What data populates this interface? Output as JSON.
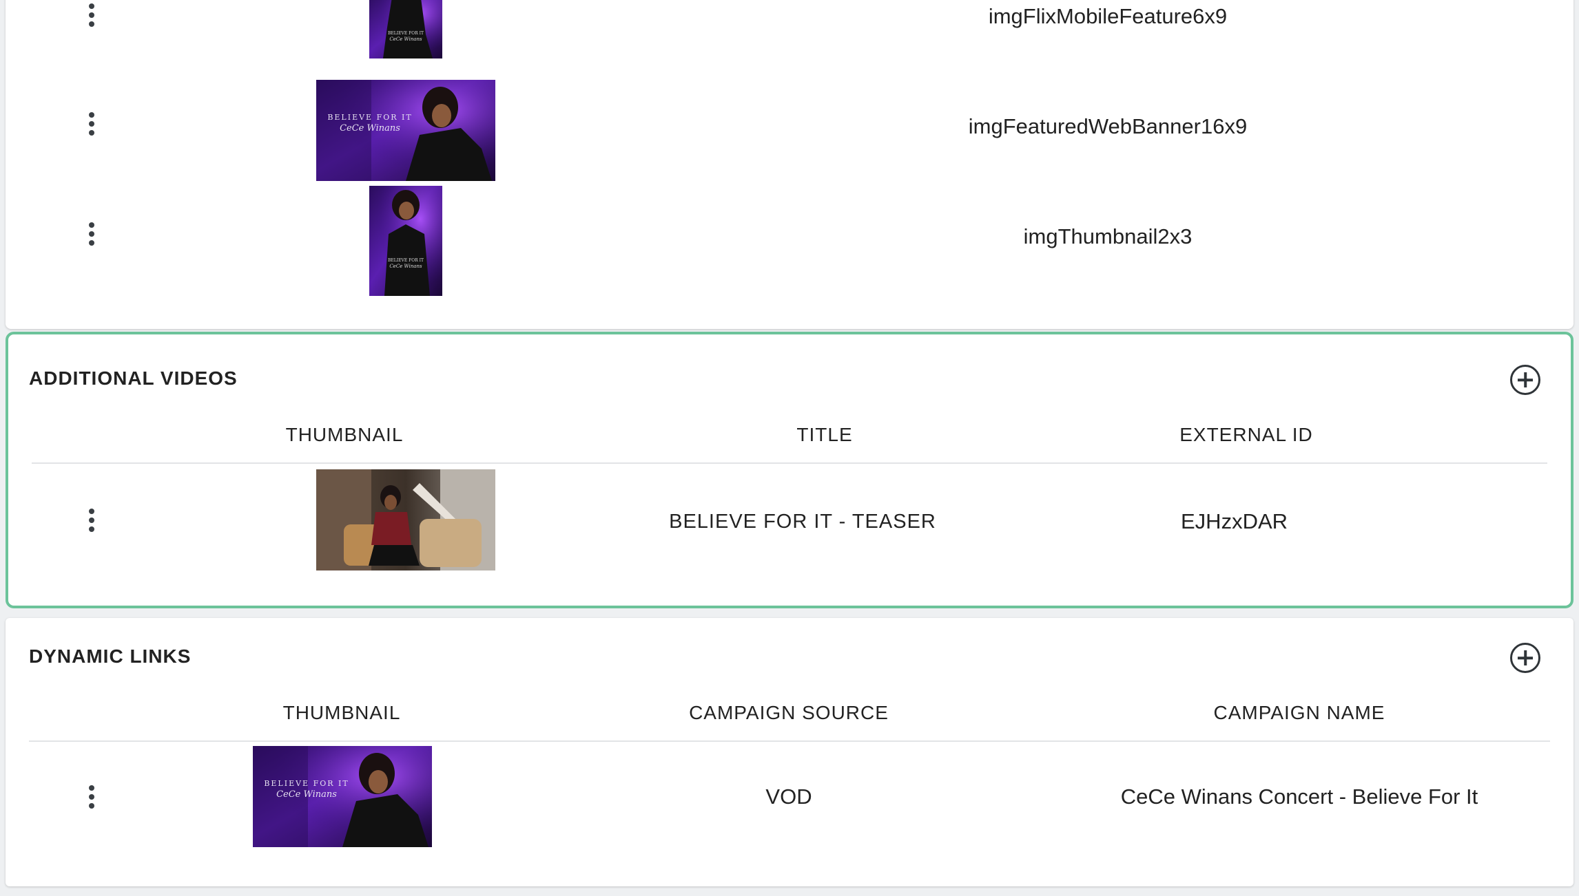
{
  "images_section": {
    "rows": [
      {
        "name": "imgFlixMobileFeature6x9"
      },
      {
        "name": "imgFeaturedWebBanner16x9"
      },
      {
        "name": "imgThumbnail2x3"
      }
    ]
  },
  "additional_videos": {
    "title": "ADDITIONAL VIDEOS",
    "columns": {
      "thumbnail": "THUMBNAIL",
      "title": "TITLE",
      "external_id": "EXTERNAL ID"
    },
    "rows": [
      {
        "title": "BELIEVE FOR IT - TEASER",
        "external_id": "EJHzxDAR"
      }
    ]
  },
  "dynamic_links": {
    "title": "DYNAMIC LINKS",
    "columns": {
      "thumbnail": "THUMBNAIL",
      "campaign_source": "CAMPAIGN SOURCE",
      "campaign_name": "CAMPAIGN NAME"
    },
    "rows": [
      {
        "campaign_source": "VOD",
        "campaign_name": "CeCe Winans Concert - Believe For It"
      }
    ]
  },
  "artwork_text": {
    "line1": "BELIEVE FOR IT",
    "line2": "CeCe Winans"
  },
  "colors": {
    "accent_border": "#6cc39a",
    "poster_purple": "#4a1d8f"
  },
  "icons": {
    "row_menu": "more-vertical-icon",
    "add": "add-circle-icon"
  }
}
